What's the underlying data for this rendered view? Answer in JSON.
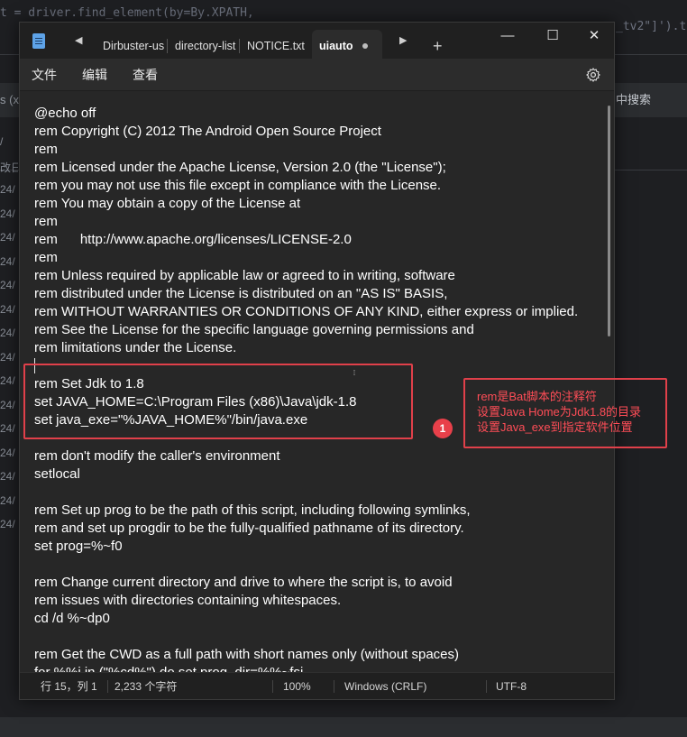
{
  "background_ide": {
    "top_code": "t = driver.find_element(by=By.XPATH,",
    "right_code": "_tv2\"]').t",
    "left_tab": "s (x",
    "search_label": "中搜索",
    "left_column": [
      "/",
      "改日",
      "24/",
      "24/",
      "24/",
      "24/",
      "24/",
      "24/",
      "24/",
      "24/",
      "24/",
      "24/",
      "24/",
      "24/",
      "24/",
      "24/",
      "24/"
    ]
  },
  "window": {
    "tabs": [
      {
        "label": "Dirbuster-us",
        "active": false
      },
      {
        "label": "directory-list",
        "active": false
      },
      {
        "label": "NOTICE.txt",
        "active": false
      },
      {
        "label": "uiauto",
        "active": true
      }
    ],
    "controls": {
      "minimize": "—",
      "maximize": "☐",
      "close": "✕"
    },
    "menu": [
      "文件",
      "编辑",
      "查看"
    ],
    "code_lines": [
      "@echo off",
      "rem Copyright (C) 2012 The Android Open Source Project",
      "rem",
      "rem Licensed under the Apache License, Version 2.0 (the \"License\");",
      "rem you may not use this file except in compliance with the License.",
      "rem You may obtain a copy of the License at",
      "rem",
      "rem      http://www.apache.org/licenses/LICENSE-2.0",
      "rem",
      "rem Unless required by applicable law or agreed to in writing, software",
      "rem distributed under the License is distributed on an \"AS IS\" BASIS,",
      "rem WITHOUT WARRANTIES OR CONDITIONS OF ANY KIND, either express or implied.",
      "rem See the License for the specific language governing permissions and",
      "rem limitations under the License.",
      "",
      "rem Set Jdk to 1.8",
      "set JAVA_HOME=C:\\Program Files (x86)\\Java\\jdk-1.8",
      "set java_exe=\"%JAVA_HOME%\"/bin/java.exe",
      "",
      "rem don't modify the caller's environment",
      "setlocal",
      "",
      "rem Set up prog to be the path of this script, including following symlinks,",
      "rem and set up progdir to be the fully-qualified pathname of its directory.",
      "set prog=%~f0",
      "",
      "rem Change current directory and drive to where the script is, to avoid",
      "rem issues with directories containing whitespaces.",
      "cd /d %~dp0",
      "",
      "rem Get the CWD as a full path with short names only (without spaces)",
      "for %%i in (\"%cd%\") do set prog_dir=%%~fsi"
    ],
    "status": {
      "position": "行 15，列 1",
      "chars": "2,233 个字符",
      "zoom": "100%",
      "line_ending": "Windows (CRLF)",
      "encoding": "UTF-8"
    }
  },
  "annotation": {
    "badge": "1",
    "lines": [
      "rem是Bat脚本的注释符",
      "设置Java Home为Jdk1.8的目录",
      "设置Java_exe到指定软件位置"
    ],
    "color": "#e0404a"
  }
}
